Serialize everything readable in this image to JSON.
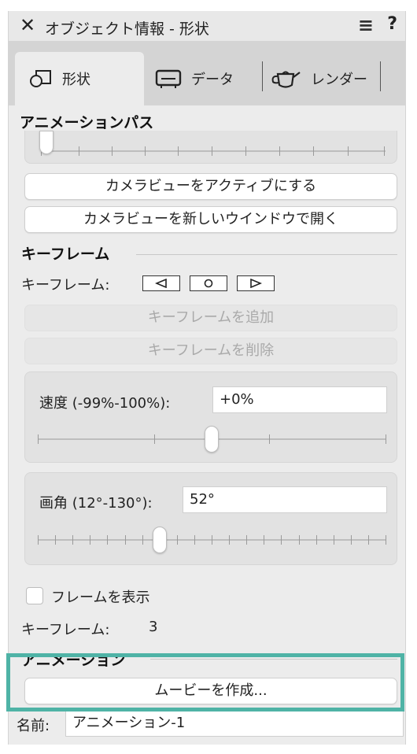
{
  "window": {
    "title": "オブジェクト情報 - 形状",
    "close_glyph": "✕",
    "menu_glyph": "≡",
    "help_glyph": "?"
  },
  "tabs": [
    {
      "label": "形状",
      "icon": "shape-icon",
      "active": true
    },
    {
      "label": "データ",
      "icon": "data-icon",
      "active": false
    },
    {
      "label": "レンダー",
      "icon": "teapot-icon",
      "active": false
    }
  ],
  "animation_path": {
    "section_title": "アニメーションパス"
  },
  "camera": {
    "activate_button": "カメラビューをアクティブにする",
    "open_new_window_button": "カメラビューを新しいウインドウで開く"
  },
  "keyframes": {
    "section_title": "キーフレーム",
    "nav_label": "キーフレーム:",
    "prev_icon": "triangle-left-icon",
    "current_icon": "circle-icon",
    "next_icon": "triangle-right-icon",
    "add_button": "キーフレームを追加",
    "delete_button": "キーフレームを削除"
  },
  "speed": {
    "label": "速度 (-99%-100%):",
    "value": "+0%",
    "slider_fraction": 0.5
  },
  "angle": {
    "label": "画角 (12°-130°):",
    "value": "52°"
  },
  "show_frames": {
    "label": "フレームを表示",
    "checked": false
  },
  "keyframe_count": {
    "label": "キーフレーム:",
    "value": "3"
  },
  "animation": {
    "section_title": "アニメーション",
    "create_movie_button": "ムービーを作成..."
  },
  "name": {
    "label": "名前:",
    "value": "アニメーション-1"
  },
  "colors": {
    "highlight": "#4fb3a6",
    "panel_bg": "#ececec"
  }
}
